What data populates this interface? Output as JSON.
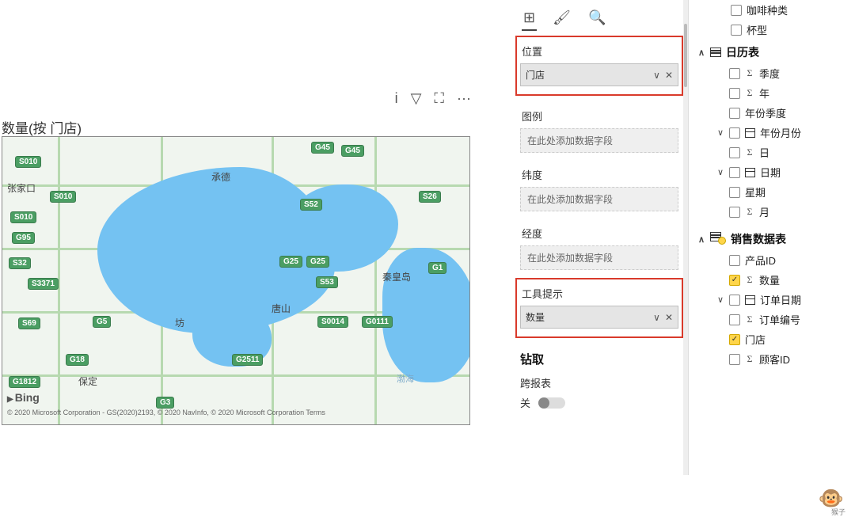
{
  "map": {
    "title": "数量(按 门店)",
    "bing": "Bing",
    "credits": "© 2020 Microsoft Corporation - GS(2020)2193, © 2020 NavInfo, © 2020 Microsoft Corporation  Terms",
    "sea": "渤海",
    "toolbar": {
      "info": "i",
      "filter": "▽",
      "focus": "⛶",
      "more": "···"
    },
    "cities": {
      "zhangjiakou": "张家口",
      "chengde": "承德",
      "tangshan": "唐山",
      "qinhuangdao": "秦皇岛",
      "baoding": "保定",
      "fang": "坊"
    },
    "badges": {
      "s010a": "S010",
      "s010b": "S010",
      "s010c": "S010",
      "g95": "G95",
      "s32": "S32",
      "s3371": "S3371",
      "s69": "S69",
      "g5": "G5",
      "g18": "G18",
      "g1812": "G1812",
      "g45a": "G45",
      "g45b": "G45",
      "s52": "S52",
      "g25a": "G25",
      "g25b": "G25",
      "s53": "S53",
      "s0014": "S0014",
      "g0111": "G0111",
      "g2511": "G2511",
      "g3": "G3",
      "s26": "S26",
      "g1": "G1"
    }
  },
  "viz": {
    "tabs": {
      "fields": "⊞",
      "format": "🖌",
      "analytics": "🔍"
    },
    "location": {
      "label": "位置",
      "value": "门店"
    },
    "legend": {
      "label": "图例",
      "placeholder": "在此处添加数据字段"
    },
    "latitude": {
      "label": "纬度",
      "placeholder": "在此处添加数据字段"
    },
    "longitude": {
      "label": "经度",
      "placeholder": "在此处添加数据字段"
    },
    "tooltip": {
      "label": "工具提示",
      "value": "数量"
    },
    "drill": {
      "header": "钻取",
      "cross": "跨报表",
      "state": "关"
    }
  },
  "fields": {
    "top": [
      {
        "label": "咖啡种类",
        "checked": false
      },
      {
        "label": "杯型",
        "checked": false
      }
    ],
    "calendar": {
      "header": "日历表",
      "rows": [
        {
          "caret": "",
          "checked": false,
          "sigma": true,
          "cal": false,
          "label": "季度"
        },
        {
          "caret": "",
          "checked": false,
          "sigma": true,
          "cal": false,
          "label": "年"
        },
        {
          "caret": "",
          "checked": false,
          "sigma": false,
          "cal": false,
          "label": "年份季度"
        },
        {
          "caret": "∨",
          "checked": false,
          "sigma": false,
          "cal": true,
          "label": "年份月份"
        },
        {
          "caret": "",
          "checked": false,
          "sigma": true,
          "cal": false,
          "label": "日"
        },
        {
          "caret": "∨",
          "checked": false,
          "sigma": false,
          "cal": true,
          "label": "日期"
        },
        {
          "caret": "",
          "checked": false,
          "sigma": false,
          "cal": false,
          "label": "星期"
        },
        {
          "caret": "",
          "checked": false,
          "sigma": true,
          "cal": false,
          "label": "月"
        }
      ]
    },
    "sales": {
      "header": "销售数据表",
      "rows": [
        {
          "caret": "",
          "checked": false,
          "sigma": false,
          "cal": false,
          "label": "产品ID"
        },
        {
          "caret": "",
          "checked": true,
          "sigma": true,
          "cal": false,
          "label": "数量"
        },
        {
          "caret": "∨",
          "checked": false,
          "sigma": false,
          "cal": true,
          "label": "订单日期"
        },
        {
          "caret": "",
          "checked": false,
          "sigma": true,
          "cal": false,
          "label": "订单编号"
        },
        {
          "caret": "",
          "checked": true,
          "sigma": false,
          "cal": false,
          "label": "门店"
        },
        {
          "caret": "",
          "checked": false,
          "sigma": true,
          "cal": false,
          "label": "顾客ID"
        }
      ]
    }
  },
  "monkey": "猴子"
}
